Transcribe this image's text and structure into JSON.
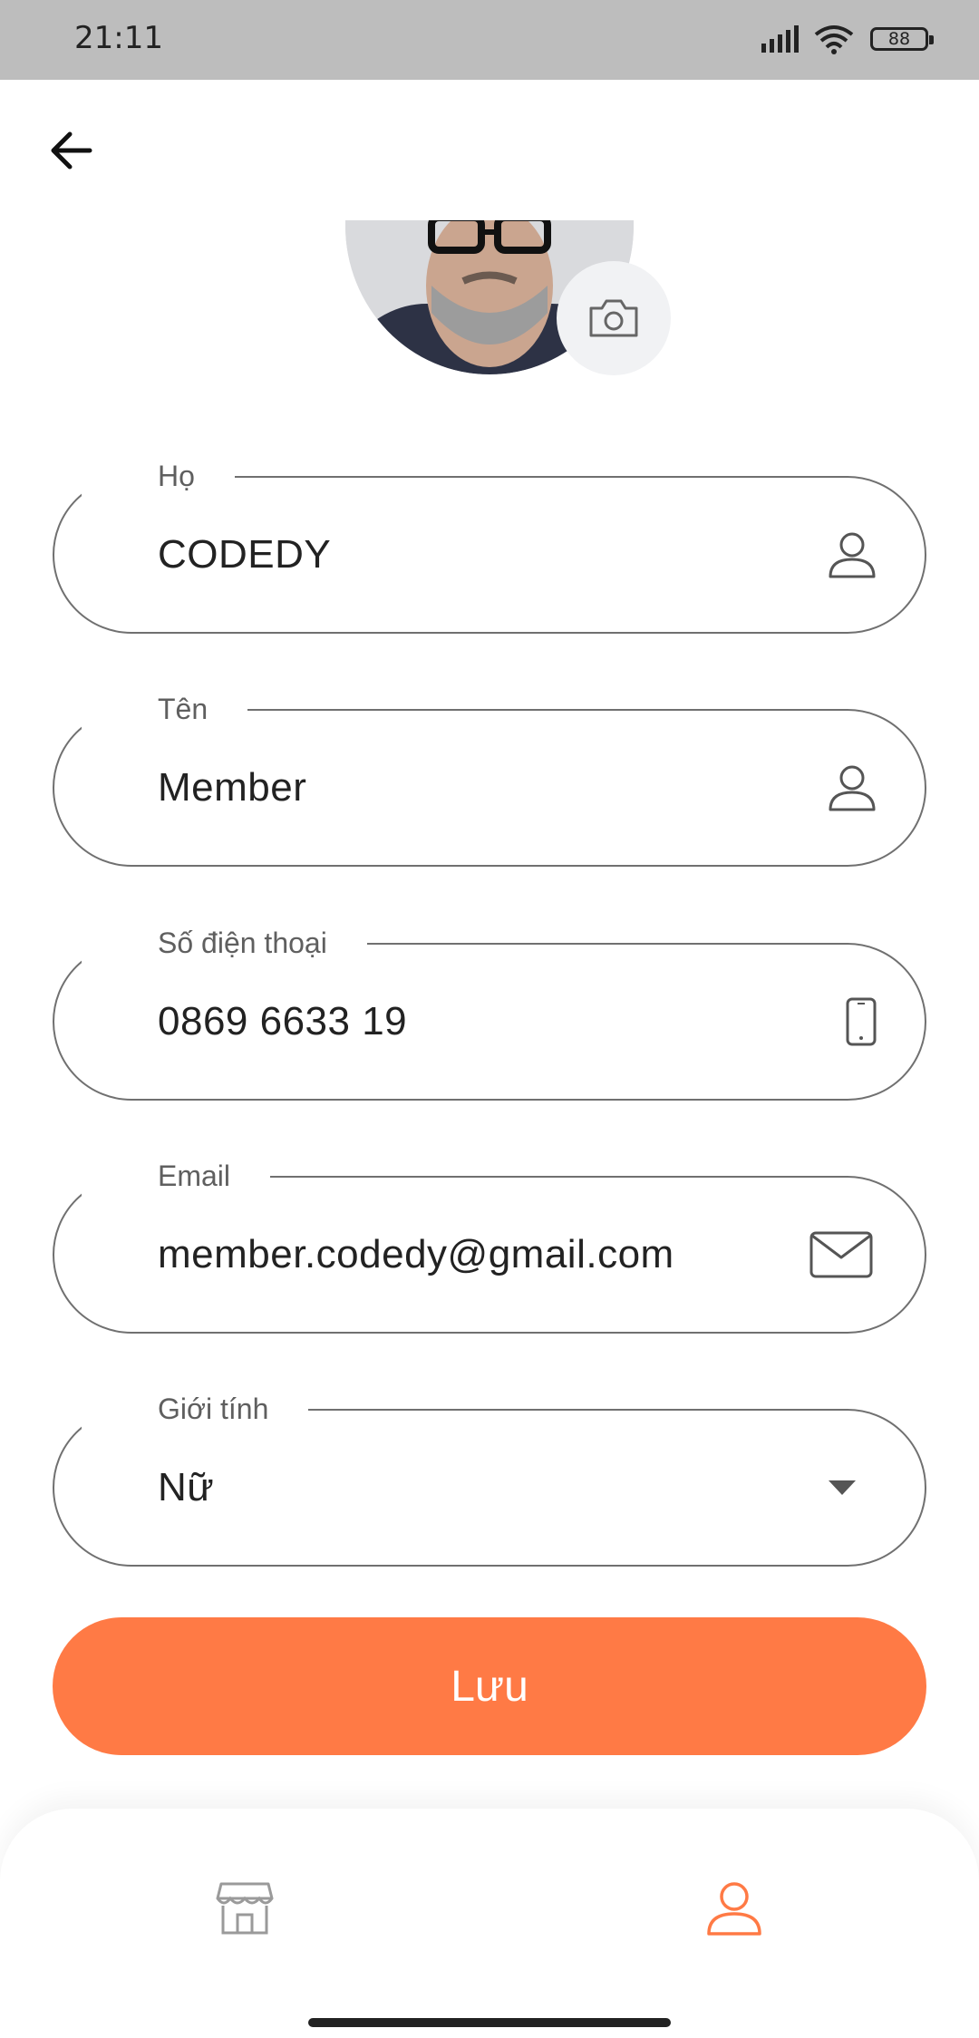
{
  "status_bar": {
    "time": "21:11",
    "battery": "88"
  },
  "profile": {
    "fields": [
      {
        "label": "Họ",
        "value": "CODEDY",
        "icon": "person-icon"
      },
      {
        "label": "Tên",
        "value": "Member",
        "icon": "person-icon"
      },
      {
        "label": "Số điện thoại",
        "value": "0869 6633 19",
        "icon": "phone-icon"
      },
      {
        "label": "Email",
        "value": "member.codedy@gmail.com",
        "icon": "mail-icon"
      },
      {
        "label": "Giới tính",
        "value": "Nữ",
        "icon": "dropdown-arrow-icon"
      }
    ],
    "save_label": "Lưu"
  },
  "bottom_nav": {
    "items": [
      {
        "icon": "store-icon",
        "active": false
      },
      {
        "icon": "person-icon",
        "active": true
      }
    ],
    "accent_color": "#ff7a45",
    "inactive_color": "#9a9a9a"
  }
}
